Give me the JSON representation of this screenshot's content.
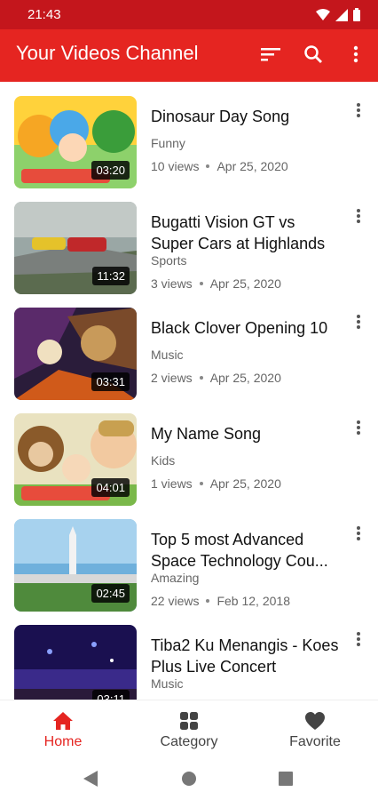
{
  "status_bar": {
    "time": "21:43"
  },
  "app_bar": {
    "title": "Your Videos Channel"
  },
  "videos": [
    {
      "title": "Dinosaur Day Song",
      "category": "Funny",
      "views": "10 views",
      "date": "Apr 25, 2020",
      "duration": "03:20"
    },
    {
      "title": "Bugatti Vision GT vs Super Cars at Highlands",
      "category": "Sports",
      "views": "3 views",
      "date": "Apr 25, 2020",
      "duration": "11:32"
    },
    {
      "title": "Black Clover Opening 10",
      "category": "Music",
      "views": "2 views",
      "date": "Apr 25, 2020",
      "duration": "03:31"
    },
    {
      "title": "My Name Song",
      "category": "Kids",
      "views": "1 views",
      "date": "Apr 25, 2020",
      "duration": "04:01"
    },
    {
      "title": "Top 5 most Advanced Space Technology Cou...",
      "category": "Amazing",
      "views": "22 views",
      "date": "Feb 12, 2018",
      "duration": "02:45"
    },
    {
      "title": "Tiba2 Ku Menangis - Koes Plus Live Concert",
      "category": "Music",
      "views": "",
      "date": "",
      "duration": "03:11"
    }
  ],
  "bottom_nav": [
    {
      "label": "Home",
      "icon": "home-icon",
      "active": true
    },
    {
      "label": "Category",
      "icon": "grid-icon",
      "active": false
    },
    {
      "label": "Favorite",
      "icon": "heart-icon",
      "active": false
    }
  ],
  "colors": {
    "primary": "#e52521",
    "status_bar": "#c4161c",
    "inactive": "#444444"
  }
}
